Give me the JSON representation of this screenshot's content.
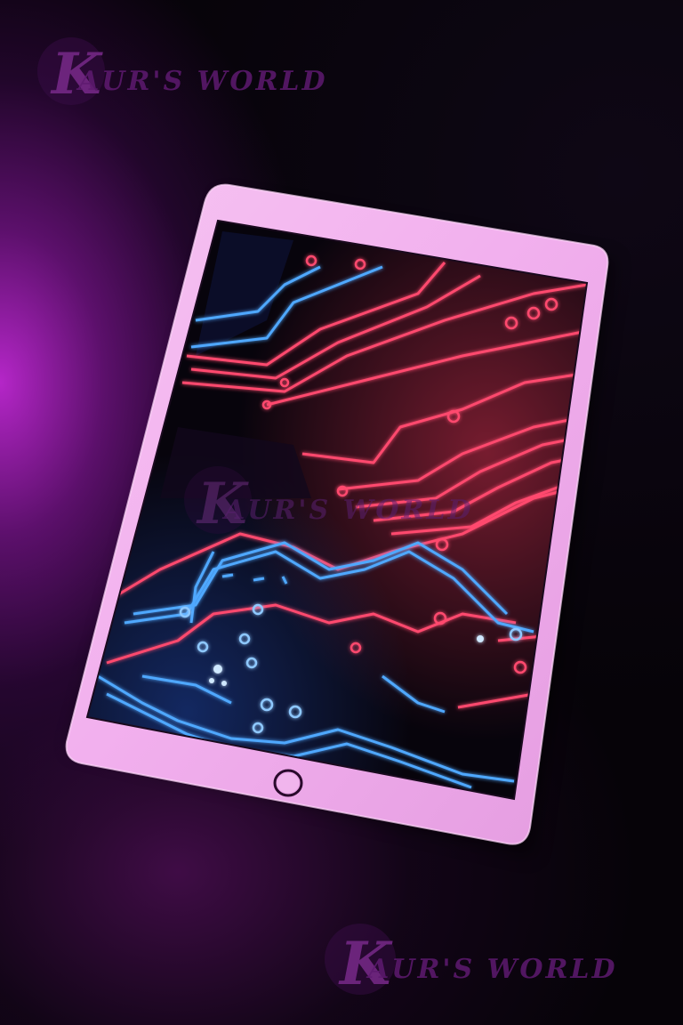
{
  "watermark": {
    "text": "KAUR'S WORLD"
  },
  "colors": {
    "background": "#060308",
    "glow_magenta": "#be28d2",
    "tablet_frame": "#f4b8f0",
    "screen_black": "#07040c",
    "trace_red": "#ff4a6e",
    "trace_blue": "#4fa8ff",
    "watermark_purple": "#5a1a6e"
  },
  "icons": [
    "home-button-icon"
  ]
}
